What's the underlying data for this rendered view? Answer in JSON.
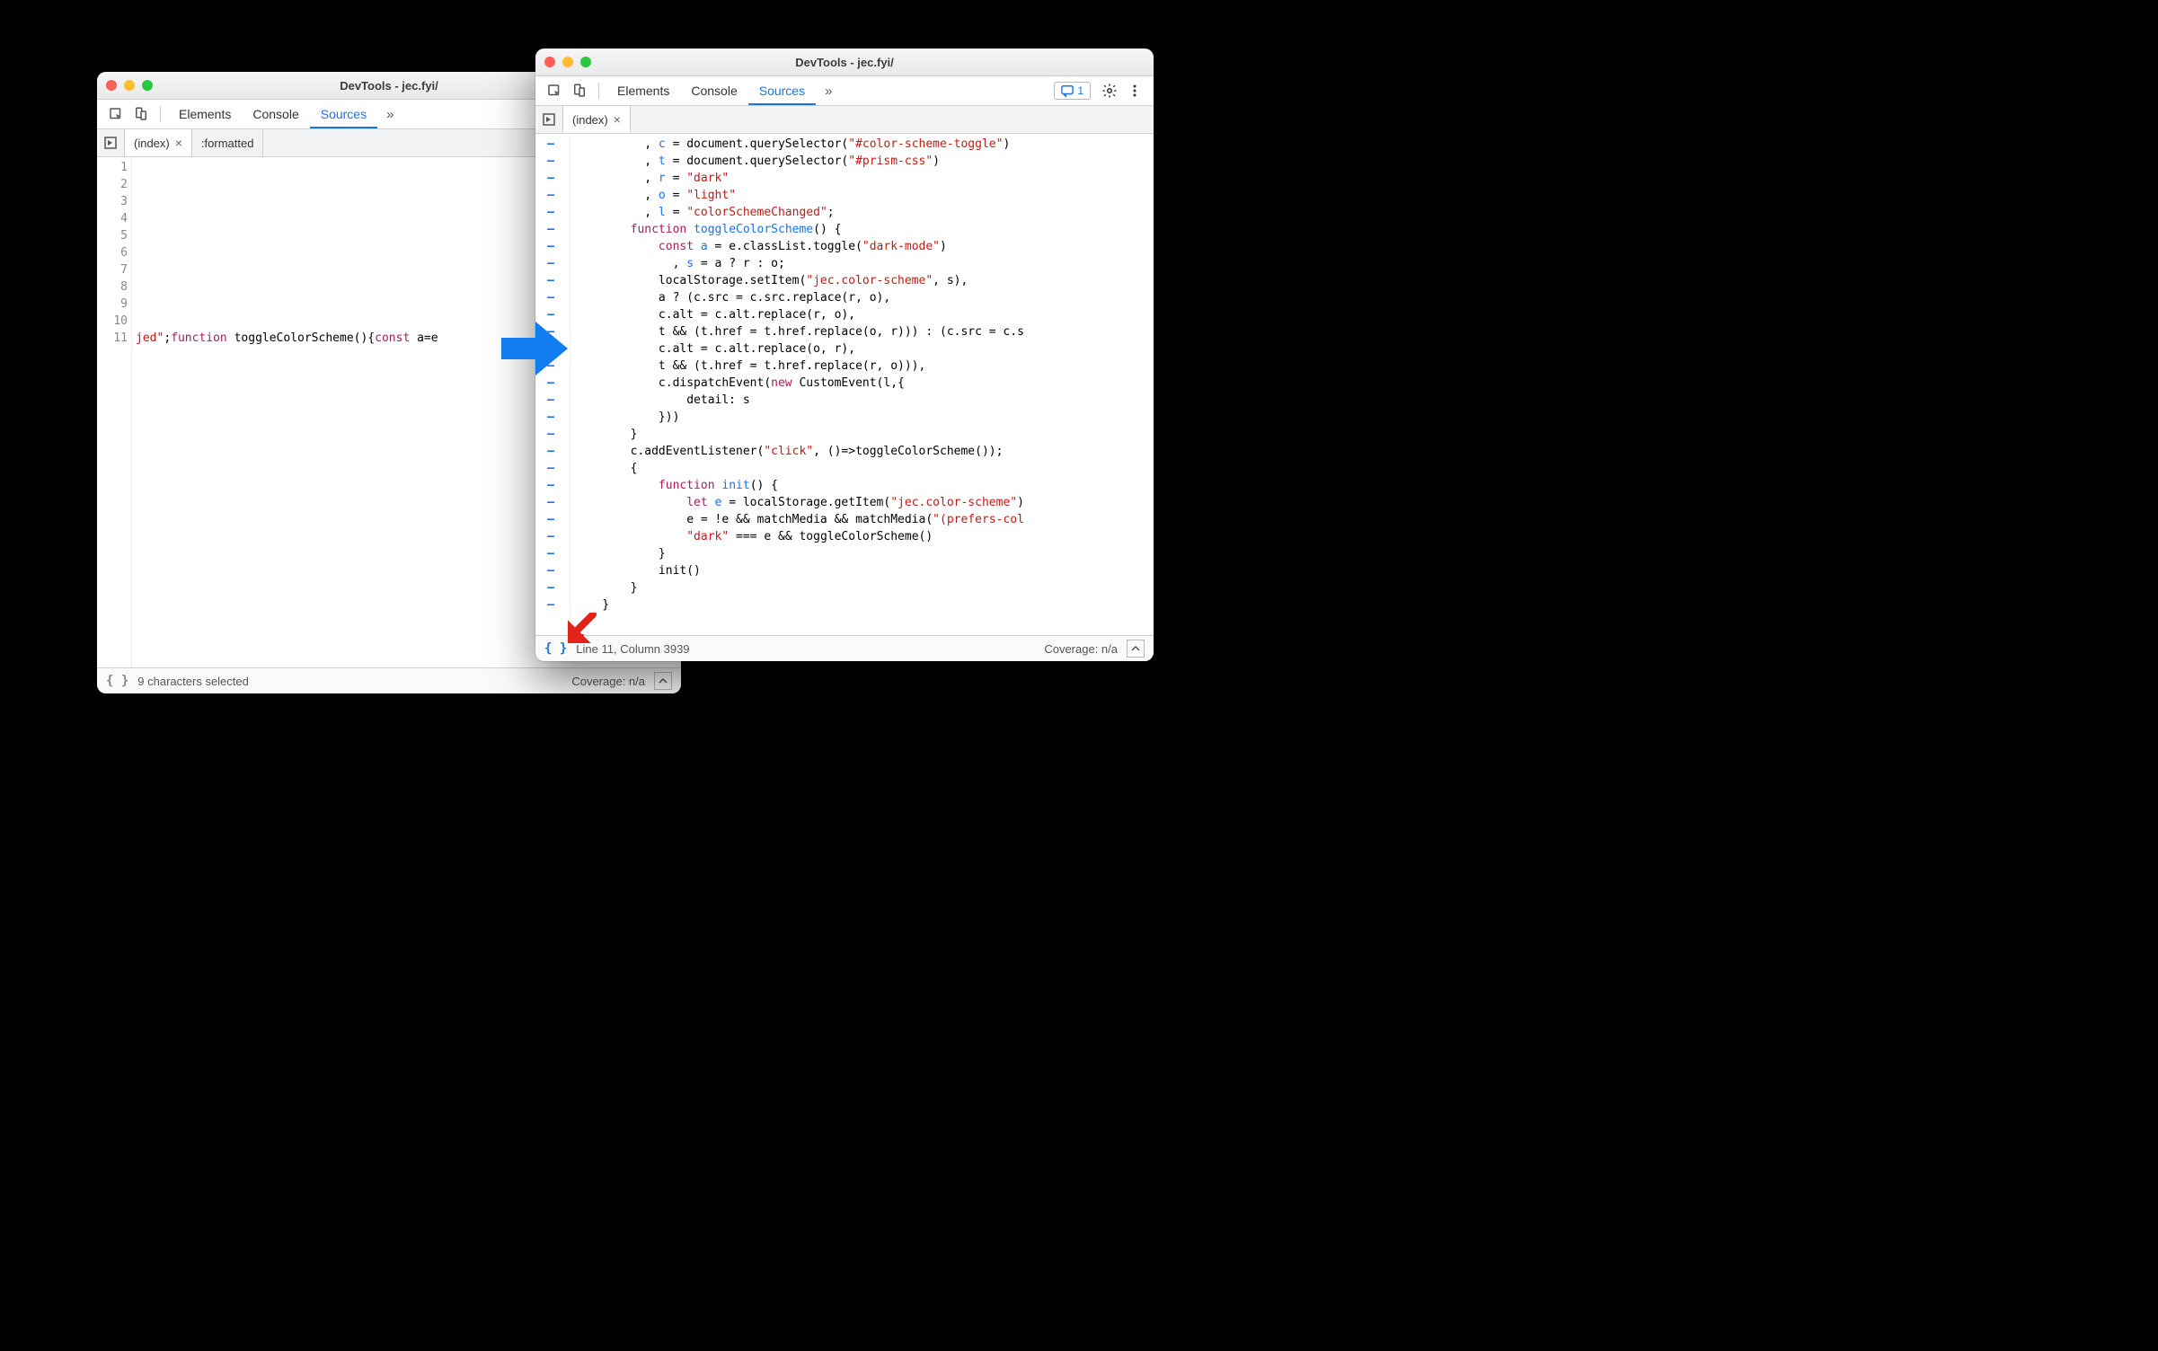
{
  "left_window": {
    "title": "DevTools - jec.fyi/",
    "tabs": {
      "elements": "Elements",
      "console": "Console",
      "sources": "Sources"
    },
    "file_tabs": {
      "index": "(index)",
      "formatted": ":formatted"
    },
    "gutter_lines": [
      "1",
      "2",
      "3",
      "4",
      "5",
      "6",
      "7",
      "8",
      "9",
      "10",
      "11"
    ],
    "code_line11": {
      "seg1": "jed\"",
      "seg2": ";",
      "seg3": "function",
      "seg4": " toggleColorScheme(){",
      "seg5": "const",
      "seg6": " a=e"
    },
    "status_left": "9 characters selected",
    "status_right": "Coverage: n/a"
  },
  "right_window": {
    "title": "DevTools - jec.fyi/",
    "tabs": {
      "elements": "Elements",
      "console": "Console",
      "sources": "Sources"
    },
    "issues_count": "1",
    "file_tab": "(index)",
    "code_lines": [
      [
        {
          "cls": "tok-plain",
          "t": "          , "
        },
        {
          "cls": "tok-decl",
          "t": "c"
        },
        {
          "cls": "tok-plain",
          "t": " = document.querySelector("
        },
        {
          "cls": "tok-str",
          "t": "\"#color-scheme-toggle\""
        },
        {
          "cls": "tok-plain",
          "t": ")"
        }
      ],
      [
        {
          "cls": "tok-plain",
          "t": "          , "
        },
        {
          "cls": "tok-decl",
          "t": "t"
        },
        {
          "cls": "tok-plain",
          "t": " = document.querySelector("
        },
        {
          "cls": "tok-str",
          "t": "\"#prism-css\""
        },
        {
          "cls": "tok-plain",
          "t": ")"
        }
      ],
      [
        {
          "cls": "tok-plain",
          "t": "          , "
        },
        {
          "cls": "tok-decl",
          "t": "r"
        },
        {
          "cls": "tok-plain",
          "t": " = "
        },
        {
          "cls": "tok-str",
          "t": "\"dark\""
        }
      ],
      [
        {
          "cls": "tok-plain",
          "t": "          , "
        },
        {
          "cls": "tok-decl",
          "t": "o"
        },
        {
          "cls": "tok-plain",
          "t": " = "
        },
        {
          "cls": "tok-str",
          "t": "\"light\""
        }
      ],
      [
        {
          "cls": "tok-plain",
          "t": "          , "
        },
        {
          "cls": "tok-decl",
          "t": "l"
        },
        {
          "cls": "tok-plain",
          "t": " = "
        },
        {
          "cls": "tok-str",
          "t": "\"colorSchemeChanged\""
        },
        {
          "cls": "tok-plain",
          "t": ";"
        }
      ],
      [
        {
          "cls": "tok-plain",
          "t": "        "
        },
        {
          "cls": "tok-kw",
          "t": "function"
        },
        {
          "cls": "tok-plain",
          "t": " "
        },
        {
          "cls": "tok-decl",
          "t": "toggleColorScheme"
        },
        {
          "cls": "tok-plain",
          "t": "() {"
        }
      ],
      [
        {
          "cls": "tok-plain",
          "t": "            "
        },
        {
          "cls": "tok-kw",
          "t": "const"
        },
        {
          "cls": "tok-plain",
          "t": " "
        },
        {
          "cls": "tok-decl",
          "t": "a"
        },
        {
          "cls": "tok-plain",
          "t": " = e.classList.toggle("
        },
        {
          "cls": "tok-str",
          "t": "\"dark-mode\""
        },
        {
          "cls": "tok-plain",
          "t": ")"
        }
      ],
      [
        {
          "cls": "tok-plain",
          "t": "              , "
        },
        {
          "cls": "tok-decl",
          "t": "s"
        },
        {
          "cls": "tok-plain",
          "t": " = a ? r : o;"
        }
      ],
      [
        {
          "cls": "tok-plain",
          "t": "            localStorage.setItem("
        },
        {
          "cls": "tok-str",
          "t": "\"jec.color-scheme\""
        },
        {
          "cls": "tok-plain",
          "t": ", s),"
        }
      ],
      [
        {
          "cls": "tok-plain",
          "t": "            a ? (c.src = c.src.replace(r, o),"
        }
      ],
      [
        {
          "cls": "tok-plain",
          "t": "            c.alt = c.alt.replace(r, o),"
        }
      ],
      [
        {
          "cls": "tok-plain",
          "t": "            t && (t.href = t.href.replace(o, r))) : (c.src = c.s"
        }
      ],
      [
        {
          "cls": "tok-plain",
          "t": "            c.alt = c.alt.replace(o, r),"
        }
      ],
      [
        {
          "cls": "tok-plain",
          "t": "            t && (t.href = t.href.replace(r, o))),"
        }
      ],
      [
        {
          "cls": "tok-plain",
          "t": "            c.dispatchEvent("
        },
        {
          "cls": "tok-kw",
          "t": "new"
        },
        {
          "cls": "tok-plain",
          "t": " CustomEvent(l,{"
        }
      ],
      [
        {
          "cls": "tok-plain",
          "t": "                detail: s"
        }
      ],
      [
        {
          "cls": "tok-plain",
          "t": "            }))"
        }
      ],
      [
        {
          "cls": "tok-plain",
          "t": "        }"
        }
      ],
      [
        {
          "cls": "tok-plain",
          "t": "        c.addEventListener("
        },
        {
          "cls": "tok-str",
          "t": "\"click\""
        },
        {
          "cls": "tok-plain",
          "t": ", ()=>toggleColorScheme());"
        }
      ],
      [
        {
          "cls": "tok-plain",
          "t": "        {"
        }
      ],
      [
        {
          "cls": "tok-plain",
          "t": "            "
        },
        {
          "cls": "tok-kw",
          "t": "function"
        },
        {
          "cls": "tok-plain",
          "t": " "
        },
        {
          "cls": "tok-decl",
          "t": "init"
        },
        {
          "cls": "tok-plain",
          "t": "() {"
        }
      ],
      [
        {
          "cls": "tok-plain",
          "t": "                "
        },
        {
          "cls": "tok-kw",
          "t": "let"
        },
        {
          "cls": "tok-plain",
          "t": " "
        },
        {
          "cls": "tok-decl",
          "t": "e"
        },
        {
          "cls": "tok-plain",
          "t": " = localStorage.getItem("
        },
        {
          "cls": "tok-str",
          "t": "\"jec.color-scheme\""
        },
        {
          "cls": "tok-plain",
          "t": ")"
        }
      ],
      [
        {
          "cls": "tok-plain",
          "t": "                e = !e && matchMedia && matchMedia("
        },
        {
          "cls": "tok-str",
          "t": "\"(prefers-col"
        }
      ],
      [
        {
          "cls": "tok-plain",
          "t": "                "
        },
        {
          "cls": "tok-str",
          "t": "\"dark\""
        },
        {
          "cls": "tok-plain",
          "t": " === e && toggleColorScheme()"
        }
      ],
      [
        {
          "cls": "tok-plain",
          "t": "            }"
        }
      ],
      [
        {
          "cls": "tok-plain",
          "t": "            init()"
        }
      ],
      [
        {
          "cls": "tok-plain",
          "t": "        }"
        }
      ],
      [
        {
          "cls": "tok-plain",
          "t": "    }"
        }
      ]
    ],
    "status_left": "Line 11, Column 3939",
    "status_right": "Coverage: n/a"
  }
}
